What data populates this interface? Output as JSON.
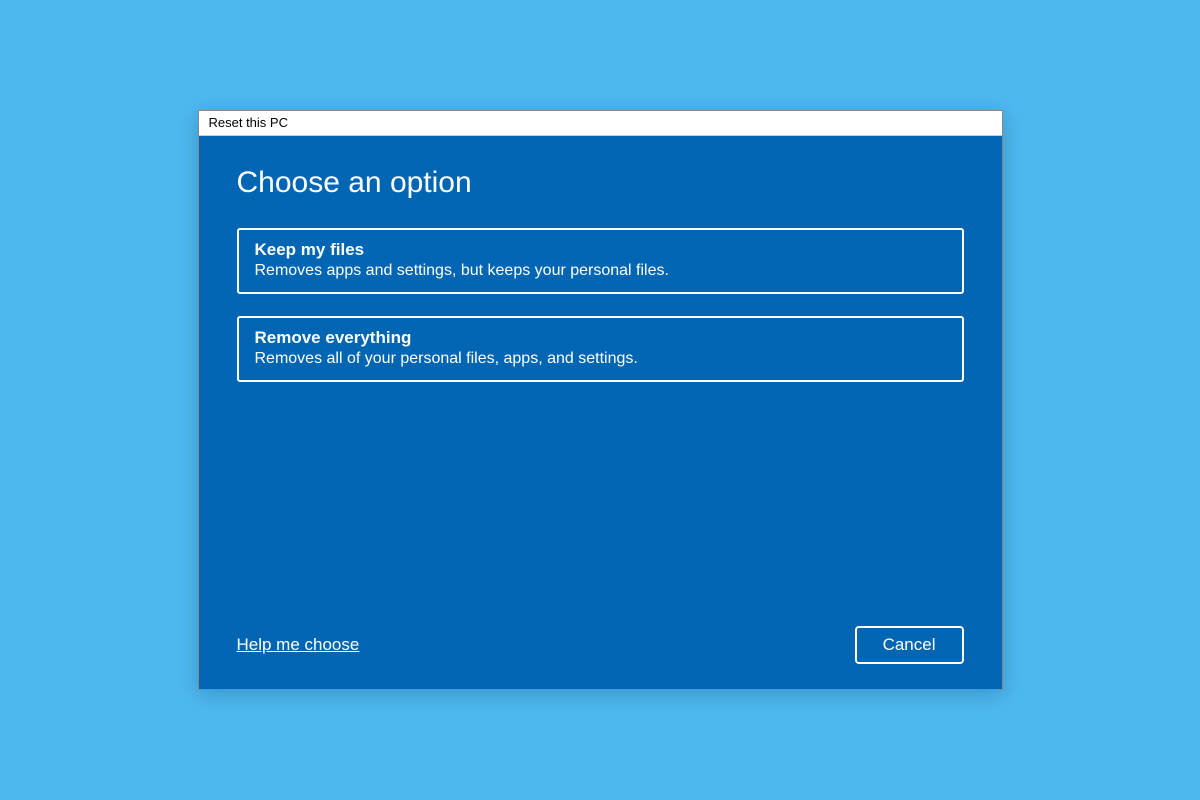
{
  "dialog": {
    "title": "Reset this PC",
    "heading": "Choose an option",
    "options": [
      {
        "title": "Keep my files",
        "description": "Removes apps and settings, but keeps your personal files."
      },
      {
        "title": "Remove everything",
        "description": "Removes all of your personal files, apps, and settings."
      }
    ],
    "help_link": "Help me choose",
    "cancel_label": "Cancel"
  }
}
